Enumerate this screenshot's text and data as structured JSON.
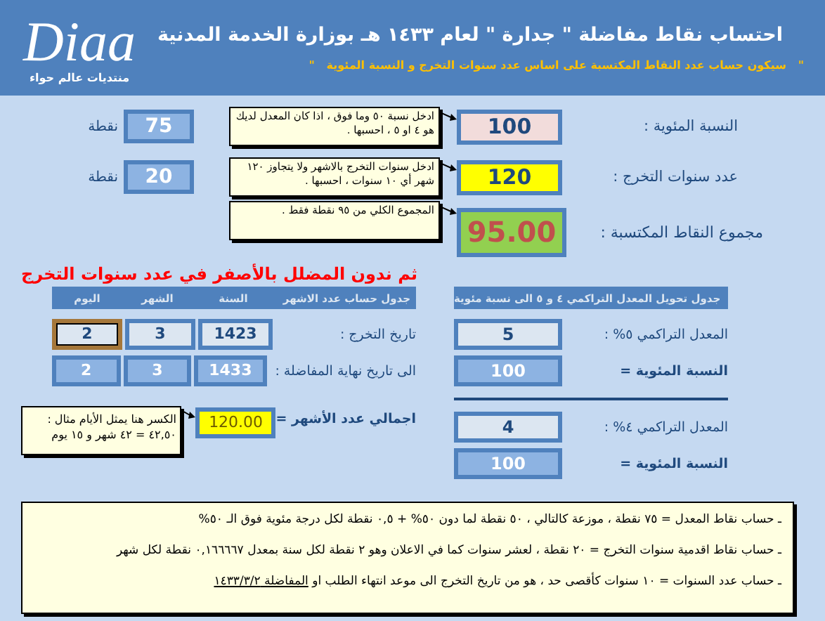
{
  "header": {
    "logo": "Diaa",
    "forum": "منتديات عالم حواء",
    "title": "احتساب نقاط مفاضلة \" جدارة \" لعام ١٤٣٣ هـ بوزارة الخدمة المدنية",
    "subtitle": "\"   سيكون حساب عدد النقاط المكتسبة على اساس عدد سنوات التخرج و النسبة المئوية   \""
  },
  "inputs": [
    {
      "kind": "percent",
      "label": "النسبة المئوية :",
      "value": "100",
      "note": "ادخل نسبة ٥٠ وما فوق ، اذا كان المعدل لديك هو ٤ او ٥ ، احسبها .",
      "points": "75",
      "unit": "نقطة"
    },
    {
      "kind": "years",
      "label": "عدد سنوات التخرج :",
      "value": "120",
      "note": "ادخل سنوات التخرج بالاشهر ولا يتجاوز ١٢٠ شهر أي ١٠ سنوات ، احسبها .",
      "points": "20",
      "unit": "نقطة"
    },
    {
      "kind": "total",
      "label": "مجموع النقاط المكتسبة :",
      "value": "95.00",
      "note": "المجموع الكلي من ٩٥ نقطة فقط ."
    }
  ],
  "instruction": "ثم ندون المضلل بالأصفر في عدد سنوات التخرج",
  "months_table": {
    "title": "جدول حساب عدد الاشهر",
    "columns": [
      "السنة",
      "الشهر",
      "اليوم"
    ],
    "rows": [
      {
        "kind": "input",
        "label": "تاريخ التخرج :",
        "cells": [
          {
            "value": "1423",
            "selected": false
          },
          {
            "value": "3",
            "selected": false
          },
          {
            "value": "2",
            "selected": true
          }
        ]
      },
      {
        "kind": "result",
        "label": "الى تاريخ نهاية المفاضلة :",
        "cells": [
          {
            "value": "1433",
            "selected": false
          },
          {
            "value": "3",
            "selected": false
          },
          {
            "value": "2",
            "selected": false
          }
        ]
      }
    ],
    "total": {
      "label": "اجمالي عدد الأشهر =",
      "value": "120.00",
      "note": "الكسر هنا يمثل الأيام مثال : ٤٢,٥٠ = ٤٢ شهر و ١٥ يوم"
    }
  },
  "gpa_table": {
    "title": "جدول تحويل المعدل التراكمي ٤ و ٥ الى نسبة مئوية",
    "groups": [
      {
        "label": "المعدل التراكمي ٥% :",
        "value": "5",
        "result_label": "النسبة المئوية =",
        "result": "100"
      },
      {
        "label": "المعدل التراكمي ٤% :",
        "value": "4",
        "result_label": "النسبة المئوية =",
        "result": "100"
      }
    ]
  },
  "notes": [
    {
      "text": "ـ حساب نقاط المعدل = ٧٥ نقطة ، موزعة كالتالي ، ٥٠ نقطة لما دون ٥٠% + ٠,٥ نقطة لكل درجة مئوية فوق الـ ٥٠%"
    },
    {
      "text": "ـ حساب نقاط اقدمية سنوات التخرج = ٢٠ نقطة ، لعشر سنوات كما في الاعلان وهو ٢ نقطة لكل سنة بمعدل ٠,١٦٦٦٦٧ نقطة لكل شهر"
    },
    {
      "text": "ـ حساب عدد السنوات = ١٠ سنوات كأقصى حد ، هو من تاريخ التخرج الى موعد انتهاء الطلب او ",
      "underlined": "المفاضلة ١٤٣٣/٣/٢"
    }
  ]
}
